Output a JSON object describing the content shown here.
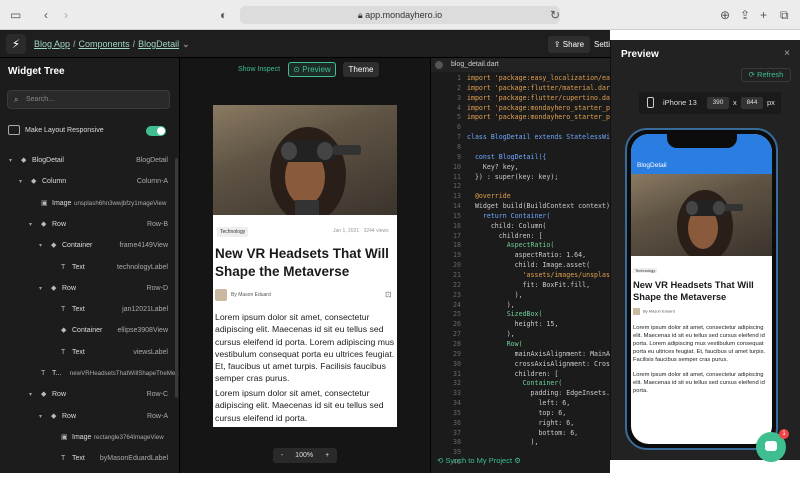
{
  "browser": {
    "url": "app.mondayhero.io"
  },
  "appbar": {
    "breadcrumb": [
      "Blog App",
      "Components",
      "BlogDetail"
    ],
    "share_label": "Share",
    "settings_label": "Settings"
  },
  "tree": {
    "title": "Widget Tree",
    "search_placeholder": "Search...",
    "responsive_label": "Make Layout Responsive",
    "rows": [
      {
        "name": "BlogDetail",
        "cls": "BlogDetail",
        "depth": 0,
        "arrow": true
      },
      {
        "name": "Column",
        "cls": "Column-A",
        "depth": 1,
        "arrow": true
      },
      {
        "name": "Image",
        "cls": "unsplash6hn3wwjbfzy1mageView",
        "depth": 2,
        "arrow": false
      },
      {
        "name": "Row",
        "cls": "Row-B",
        "depth": 2,
        "arrow": true
      },
      {
        "name": "Container",
        "cls": "frame4149View",
        "depth": 3,
        "arrow": true
      },
      {
        "name": "Text",
        "cls": "technologyLabel",
        "depth": 4,
        "arrow": false
      },
      {
        "name": "Row",
        "cls": "Row-D",
        "depth": 3,
        "arrow": true
      },
      {
        "name": "Text",
        "cls": "jan12021Label",
        "depth": 4,
        "arrow": false
      },
      {
        "name": "Container",
        "cls": "ellipse3908View",
        "depth": 4,
        "arrow": false
      },
      {
        "name": "Text",
        "cls": "viewsLabel",
        "depth": 4,
        "arrow": false
      },
      {
        "name": "T...",
        "cls": "newVRHeadsetsThatWillShapeTheMe...",
        "depth": 2,
        "arrow": false
      },
      {
        "name": "Row",
        "cls": "Row-C",
        "depth": 2,
        "arrow": true
      },
      {
        "name": "Row",
        "cls": "Row-A",
        "depth": 3,
        "arrow": true
      },
      {
        "name": "Image",
        "cls": "rectangle3764ImageView",
        "depth": 4,
        "arrow": false
      },
      {
        "name": "Text",
        "cls": "byMasonEduardLabel",
        "depth": 4,
        "arrow": false
      }
    ]
  },
  "preview": {
    "show_inspect": "Show Inspect",
    "preview_tab": "Preview",
    "theme_tab": "Theme",
    "zoom": "100%",
    "zoom_minus": "-",
    "zoom_plus": "+"
  },
  "article": {
    "tag": "Technology",
    "date": "Jan 1, 2021 · 3244 views",
    "title": "New VR Headsets That Will Shape the Metaverse",
    "author": "By Mason Eduard",
    "p1": "Lorem ipsum dolor sit amet, consectetur adipiscing elit. Maecenas id sit eu tellus sed cursus eleifend id porta. Lorem adipiscing mus vestibulum consequat porta eu ultrices feugiat. Et, faucibus ut amet turpis. Facilisis faucibus semper cras purus.",
    "p2": "Lorem ipsum dolor sit amet, consectetur adipiscing elit. Maecenas id sit eu tellus sed cursus eleifend id porta."
  },
  "code": {
    "file": "blog_detail.dart",
    "lines": [
      {
        "n": "1",
        "t": "import 'package:easy_localization/eas",
        "c": "#e0a050"
      },
      {
        "n": "2",
        "t": "import 'package:flutter/material.dart",
        "c": "#e0a050"
      },
      {
        "n": "3",
        "t": "import 'package:flutter/cupertino.dar",
        "c": "#e0a050"
      },
      {
        "n": "4",
        "t": "import 'package:mondayhero_starter_pr",
        "c": "#e0a050"
      },
      {
        "n": "5",
        "t": "import 'package:mondayhero_starter_pr",
        "c": "#e0a050"
      },
      {
        "n": "6",
        "t": "",
        "c": "#ccc"
      },
      {
        "n": "7",
        "t": "class BlogDetail extends StatelessWid",
        "c": "#6fa8ff"
      },
      {
        "n": "8",
        "t": "",
        "c": "#ccc"
      },
      {
        "n": "9",
        "t": "  const BlogDetail({",
        "c": "#6fa8ff"
      },
      {
        "n": "10",
        "t": "    Key? key,",
        "c": "#ccc"
      },
      {
        "n": "11",
        "t": "  }) : super(key: key);",
        "c": "#ccc"
      },
      {
        "n": "12",
        "t": "",
        "c": "#ccc"
      },
      {
        "n": "13",
        "t": "  @override",
        "c": "#e0a050"
      },
      {
        "n": "14",
        "t": "  Widget build(BuildContext context)",
        "c": "#ccc"
      },
      {
        "n": "15",
        "t": "    return Container(",
        "c": "#6fa8ff"
      },
      {
        "n": "16",
        "t": "      child: Column(",
        "c": "#ccc"
      },
      {
        "n": "17",
        "t": "        children: [",
        "c": "#ccc"
      },
      {
        "n": "18",
        "t": "          AspectRatio(",
        "c": "#6fcf97"
      },
      {
        "n": "19",
        "t": "            aspectRatio: 1.64,",
        "c": "#ccc"
      },
      {
        "n": "20",
        "t": "            child: Image.asset(",
        "c": "#ccc"
      },
      {
        "n": "21",
        "t": "              'assets/images/unsplash",
        "c": "#e0a050"
      },
      {
        "n": "22",
        "t": "              fit: BoxFit.fill,",
        "c": "#ccc"
      },
      {
        "n": "23",
        "t": "            ),",
        "c": "#ccc"
      },
      {
        "n": "24",
        "t": "          ),",
        "c": "#ccc"
      },
      {
        "n": "25",
        "t": "          SizedBox(",
        "c": "#6fcf97"
      },
      {
        "n": "26",
        "t": "            height: 15,",
        "c": "#ccc"
      },
      {
        "n": "27",
        "t": "          ),",
        "c": "#ccc"
      },
      {
        "n": "28",
        "t": "          Row(",
        "c": "#6fcf97"
      },
      {
        "n": "29",
        "t": "            mainAxisAlignment: MainAx",
        "c": "#ccc"
      },
      {
        "n": "30",
        "t": "            crossAxisAlignment: Cross",
        "c": "#ccc"
      },
      {
        "n": "31",
        "t": "            children: [",
        "c": "#ccc"
      },
      {
        "n": "32",
        "t": "              Container(",
        "c": "#6fcf97"
      },
      {
        "n": "33",
        "t": "                padding: EdgeInsets.o",
        "c": "#ccc"
      },
      {
        "n": "34",
        "t": "                  left: 6,",
        "c": "#ccc"
      },
      {
        "n": "35",
        "t": "                  top: 6,",
        "c": "#ccc"
      },
      {
        "n": "36",
        "t": "                  right: 6,",
        "c": "#ccc"
      },
      {
        "n": "37",
        "t": "                  bottom: 6,",
        "c": "#ccc"
      },
      {
        "n": "38",
        "t": "                ),",
        "c": "#ccc"
      },
      {
        "n": "39",
        "t": "",
        "c": "#ccc"
      },
      {
        "n": "40",
        "t": "",
        "c": "#ccc"
      }
    ],
    "sync_label": "Synch to My Project"
  },
  "pv_dialog": {
    "title": "Preview",
    "refresh_label": "Refresh",
    "device": "iPhone 13",
    "width": "390",
    "height": "844",
    "times": "x",
    "unit": "px",
    "appbar_title": "BlogDetail",
    "close": "×"
  },
  "chat": {
    "badge": "1"
  },
  "colors": {
    "accent": "#3fbf8f",
    "panel": "#1c1c1c",
    "phone_appbar": "#2a7de1"
  }
}
